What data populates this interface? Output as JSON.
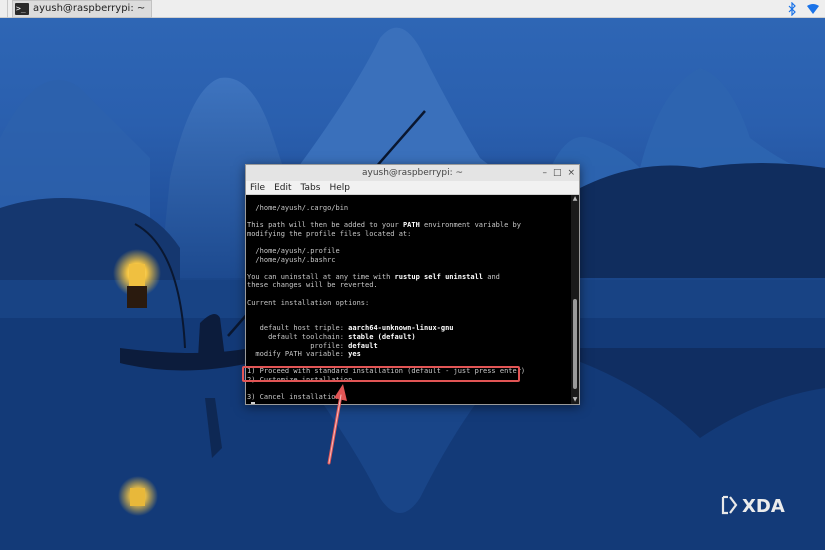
{
  "taskbar": {
    "window_task_label": "ayush@raspberrypi: ~",
    "icons": [
      "terminal-icon",
      "bluetooth-icon",
      "network-icon"
    ]
  },
  "terminal": {
    "title": "ayush@raspberrypi: ~",
    "controls": [
      "–",
      "□",
      "×"
    ],
    "menu": [
      "File",
      "Edit",
      "Tabs",
      "Help"
    ],
    "lines": {
      "l1": "  /home/ayush/.cargo/bin",
      "l3a": "This path will then be added to your ",
      "l3b": "PATH",
      "l3c": " environment variable by",
      "l4": "modifying the profile files located at:",
      "l6": "  /home/ayush/.profile",
      "l7": "  /home/ayush/.bashrc",
      "l9a": "You can uninstall at any time with ",
      "l9b": "rustup self uninstall",
      "l9c": " and",
      "l10": "these changes will be reverted.",
      "l12": "Current installation options:",
      "l15a": "   default host triple: ",
      "l15b": "aarch64-unknown-linux-gnu",
      "l16a": "     default toolchain: ",
      "l16b": "stable (default)",
      "l17a": "               profile: ",
      "l17b": "default",
      "l18a": "  modify PATH variable: ",
      "l18b": "yes",
      "l20": "1) Proceed with standard installation (default - just press enter)",
      "l21": "2) Customize installation",
      "l22": "3) Cancel installation",
      "l23": ">"
    }
  },
  "colors": {
    "highlight": "#e25555",
    "terminal_bg": "#000000",
    "terminal_text": "#c8c8c8"
  },
  "watermark": "XDA"
}
